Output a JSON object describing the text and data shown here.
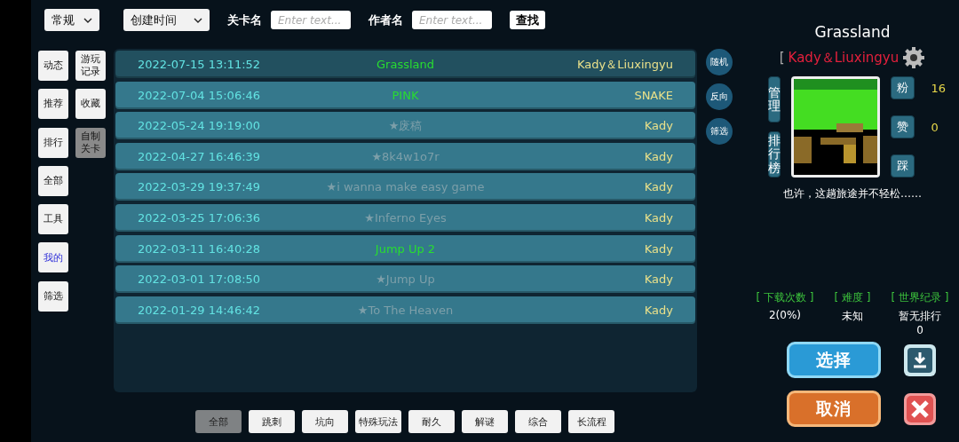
{
  "filters": {
    "category": {
      "value": "常规"
    },
    "sort": {
      "value": "创建时间"
    },
    "level_name": {
      "label": "关卡名",
      "placeholder": "Enter text..."
    },
    "author_name": {
      "label": "作者名",
      "placeholder": "Enter text..."
    },
    "search_button": "查找"
  },
  "sidebar": {
    "columns": [
      [
        {
          "label": "动态",
          "selected": false,
          "highlighted": false
        },
        {
          "label": "推荐",
          "selected": false,
          "highlighted": false
        },
        {
          "label": "排行",
          "selected": false,
          "highlighted": false
        },
        {
          "label": "全部",
          "selected": false,
          "highlighted": false
        },
        {
          "label": "工具",
          "selected": false,
          "highlighted": false
        },
        {
          "label": "我的",
          "selected": false,
          "highlighted": true
        },
        {
          "label": "筛选",
          "selected": false,
          "highlighted": false
        }
      ],
      [
        {
          "label": "游玩记录",
          "selected": false,
          "highlighted": false
        },
        {
          "label": "收藏",
          "selected": false,
          "highlighted": false
        },
        {
          "label": "自制关卡",
          "selected": true,
          "highlighted": false
        }
      ]
    ]
  },
  "levels": [
    {
      "date": "2022-07-15 13:11:52",
      "title": "Grassland",
      "author": "Kady＆Liuxingyu",
      "kind": "published",
      "selected": true
    },
    {
      "date": "2022-07-04 15:06:46",
      "title": "PINK",
      "author": "SNAKE",
      "kind": "published",
      "selected": false
    },
    {
      "date": "2022-05-24 19:19:00",
      "title": "★废稿",
      "author": "Kady",
      "kind": "draft",
      "selected": false
    },
    {
      "date": "2022-04-27 16:46:39",
      "title": "★8k4w1o7r",
      "author": "Kady",
      "kind": "draft",
      "selected": false
    },
    {
      "date": "2022-03-29 19:37:49",
      "title": "★i wanna make easy game",
      "author": "Kady",
      "kind": "draft",
      "selected": false
    },
    {
      "date": "2022-03-25 17:06:36",
      "title": "★Inferno Eyes",
      "author": "Kady",
      "kind": "draft",
      "selected": false
    },
    {
      "date": "2022-03-11 16:40:28",
      "title": "Jump Up 2",
      "author": "Kady",
      "kind": "published",
      "selected": false
    },
    {
      "date": "2022-03-01 17:08:50",
      "title": "★Jump Up",
      "author": "Kady",
      "kind": "draft",
      "selected": false
    },
    {
      "date": "2022-01-29 14:46:42",
      "title": "★To The Heaven",
      "author": "Kady",
      "kind": "draft",
      "selected": false
    }
  ],
  "side_buttons": [
    "随机",
    "反向",
    "筛选"
  ],
  "detail": {
    "title": "Grassland",
    "author_bracket": "[",
    "author": "Kady＆Liuxingyu",
    "manage_button": "管理",
    "ranking_button": "排行榜",
    "fans_label": "粉",
    "fans": "16",
    "like_label": "赞",
    "likes": "0",
    "dislike_label": "踩",
    "description": "也许，这趟旅途并不轻松……",
    "stats": [
      {
        "label": "[ 下载次数 ]",
        "value": "2(0%)"
      },
      {
        "label": "[ 难度 ]",
        "value": "未知"
      },
      {
        "label": "[ 世界纪录 ]",
        "value": "暂无排行",
        "extra": "0"
      }
    ],
    "select_button": "选择",
    "cancel_button": "取消"
  },
  "tags": [
    {
      "label": "全部",
      "selected": true
    },
    {
      "label": "跳刺",
      "selected": false
    },
    {
      "label": "坑向",
      "selected": false
    },
    {
      "label": "特殊玩法",
      "selected": false
    },
    {
      "label": "耐久",
      "selected": false
    },
    {
      "label": "解谜",
      "selected": false
    },
    {
      "label": "综合",
      "selected": false
    },
    {
      "label": "长流程",
      "selected": false
    }
  ]
}
